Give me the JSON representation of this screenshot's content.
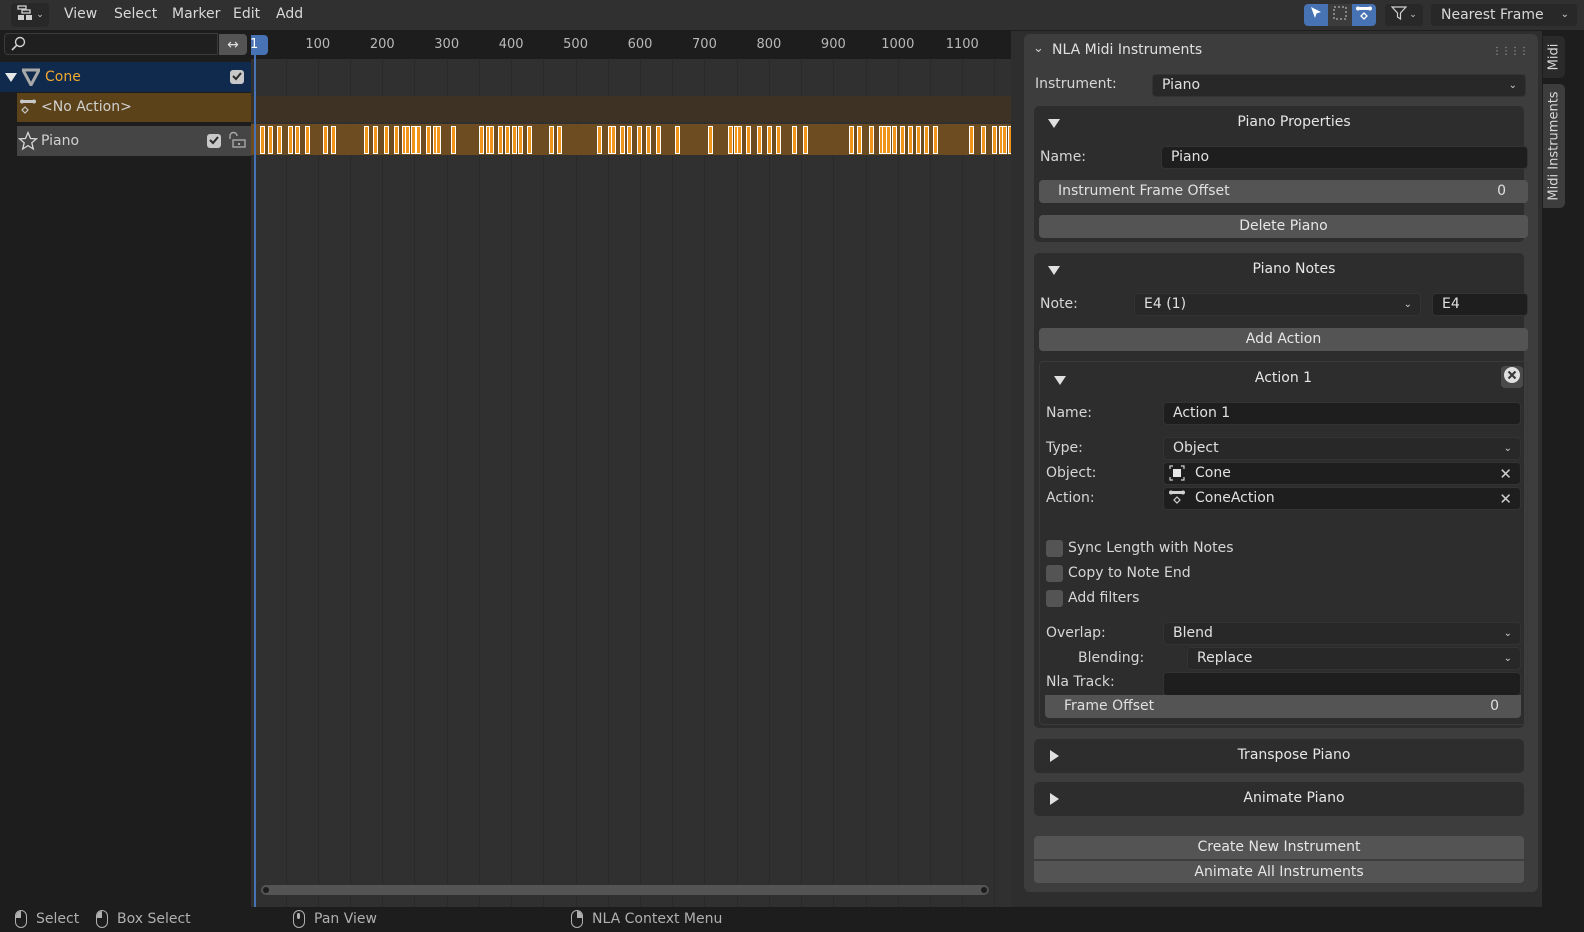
{
  "header": {
    "editor_type_icon": "nla-editor-icon",
    "menus": [
      "View",
      "Select",
      "Marker",
      "Edit",
      "Add"
    ],
    "tools": [
      {
        "icon": "select-cursor-icon",
        "active": true
      },
      {
        "icon": "box-select-icon",
        "active": false
      },
      {
        "icon": "strip-icon",
        "active": true
      }
    ],
    "filter_icon": "filter-icon",
    "snap_mode": "Nearest Frame"
  },
  "channels": {
    "search_placeholder": "",
    "object": {
      "name": "Cone",
      "icon": "cone-icon",
      "enabled": true
    },
    "action_slot": {
      "name": "<No Action>",
      "icon": "action-icon"
    },
    "track": {
      "name": "Piano",
      "icon": "star-icon",
      "enabled": true,
      "locked": false
    }
  },
  "timeline": {
    "current_frame": "1",
    "ruler_ticks": [
      "100",
      "200",
      "300",
      "400",
      "500",
      "600",
      "700",
      "800",
      "900",
      "1000",
      "1100"
    ],
    "strip_frames": [
      10,
      22,
      36,
      53,
      64,
      80,
      108,
      120,
      172,
      186,
      202,
      219,
      231,
      236,
      244,
      253,
      268,
      279,
      284,
      306,
      350,
      361,
      366,
      379,
      391,
      402,
      410,
      425,
      459,
      471,
      533,
      550,
      555,
      569,
      580,
      595,
      609,
      625,
      655,
      706,
      737,
      746,
      751,
      764,
      781,
      797,
      811,
      836,
      853,
      925,
      937,
      955,
      971,
      975,
      981,
      991,
      1004,
      1016,
      1028,
      1041,
      1054,
      1111,
      1129,
      1146,
      1157,
      1161,
      1171,
      1187,
      1201
    ]
  },
  "sidebar": {
    "tabs": [
      "Midi",
      "Midi Instruments"
    ],
    "active_tab": "Midi Instruments",
    "panel_title": "NLA Midi Instruments",
    "instrument_label": "Instrument:",
    "instrument_value": "Piano",
    "piano_properties": {
      "title": "Piano Properties",
      "name_label": "Name:",
      "name_value": "Piano",
      "frame_offset_label": "Instrument Frame Offset",
      "frame_offset_value": "0",
      "delete_label": "Delete Piano"
    },
    "piano_notes": {
      "title": "Piano Notes",
      "note_label": "Note:",
      "note_value": "E4 (1)",
      "note_search": "E4",
      "add_action_label": "Add Action",
      "action": {
        "title": "Action 1",
        "name_label": "Name:",
        "name_value": "Action 1",
        "type_label": "Type:",
        "type_value": "Object",
        "object_label": "Object:",
        "object_value": "Cone",
        "action_label": "Action:",
        "action_value": "ConeAction",
        "checkboxes": [
          {
            "label": "Sync Length with Notes",
            "checked": false
          },
          {
            "label": "Copy to Note End",
            "checked": false
          },
          {
            "label": "Add filters",
            "checked": false
          }
        ],
        "overlap_label": "Overlap:",
        "overlap_value": "Blend",
        "blending_label": "Blending:",
        "blending_value": "Replace",
        "nla_track_label": "Nla Track:",
        "nla_track_value": "",
        "frame_offset_label": "Frame Offset",
        "frame_offset_value": "0"
      }
    },
    "transpose_title": "Transpose Piano",
    "animate_title": "Animate Piano",
    "create_label": "Create New Instrument",
    "animate_all_label": "Animate All Instruments"
  },
  "statusbar": {
    "items": [
      {
        "icon": "mouse-left-icon",
        "label": "Select"
      },
      {
        "icon": "mouse-drag-icon",
        "label": "Box Select"
      },
      {
        "icon": "mouse-middle-icon",
        "label": "Pan View"
      },
      {
        "icon": "mouse-right-icon",
        "label": "NLA Context Menu"
      }
    ]
  }
}
